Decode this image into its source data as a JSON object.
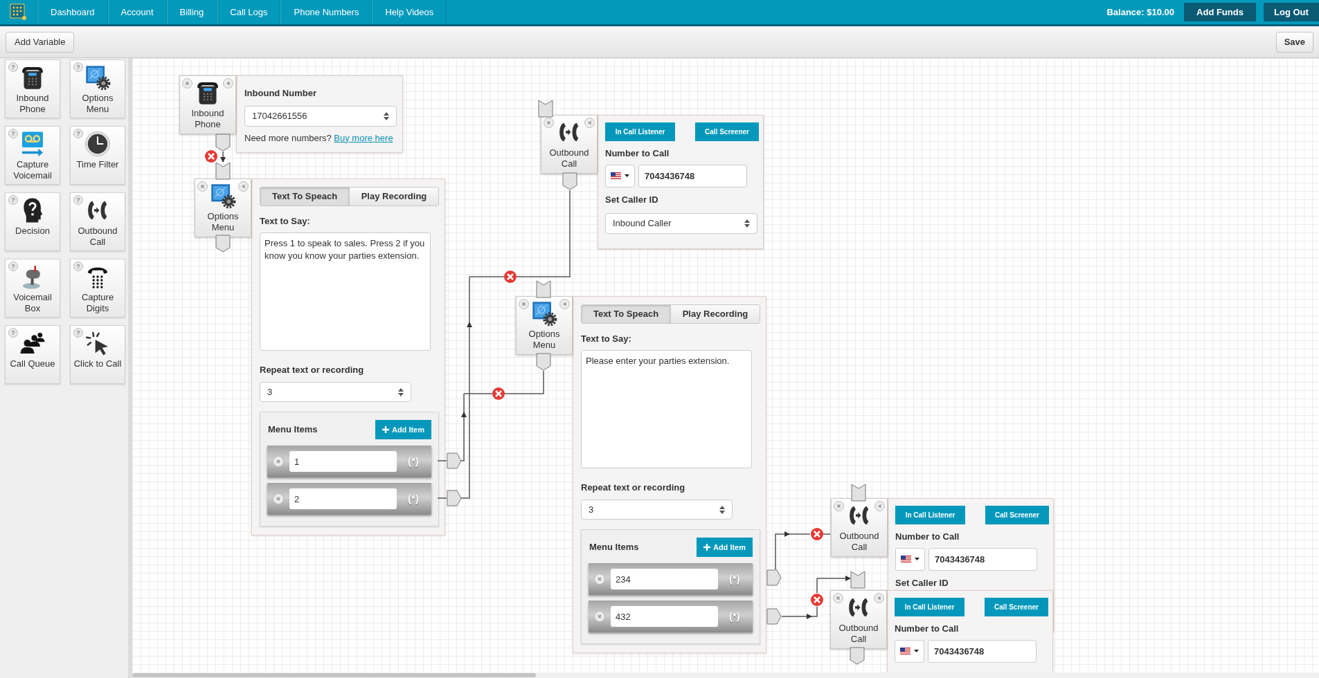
{
  "nav": {
    "items": [
      "Dashboard",
      "Account",
      "Billing",
      "Call Logs",
      "Phone Numbers",
      "Help Videos"
    ],
    "balance": "Balance: $10.00",
    "buttons": [
      "Add Funds",
      "Log Out"
    ]
  },
  "toolbar": {
    "add_variable": "Add Variable",
    "save": "Save"
  },
  "palette": [
    {
      "kind": "inbound_phone",
      "label": "Inbound Phone",
      "help": "?"
    },
    {
      "kind": "options_menu",
      "label": "Options Menu",
      "help": "?"
    },
    {
      "kind": "capture_voicemail",
      "label": "Capture Voicemail",
      "help": "?"
    },
    {
      "kind": "time_filter",
      "label": "Time Filter",
      "help": "?"
    },
    {
      "kind": "decision",
      "label": "Decision",
      "help": "?"
    },
    {
      "kind": "outbound_call",
      "label": "Outbound Call",
      "help": "?"
    },
    {
      "kind": "voicemail_box",
      "label": "Voicemail Box",
      "help": "?"
    },
    {
      "kind": "capture_digits",
      "label": "Capture Digits",
      "help": "?"
    },
    {
      "kind": "call_queue",
      "label": "Call Queue",
      "help": "?"
    },
    {
      "kind": "click_to_call",
      "label": "Click to Call",
      "help": "?"
    }
  ],
  "nodes": [
    {
      "kind": "inbound_phone",
      "label": "Inbound Phone",
      "heading": "Inbound Number",
      "number": "17042661556",
      "note": "Need more numbers?",
      "link": "Buy more here"
    },
    {
      "kind": "options_menu",
      "label": "Options Menu",
      "tabs": [
        {
          "label": "Text To Speach",
          "selected": true
        },
        {
          "label": "Play Recording",
          "selected": false
        }
      ],
      "text_label": "Text to Say:",
      "text": "Press 1 to speak to sales. Press 2 if you know you know your parties extension.",
      "repeat_label": "Repeat text or recording",
      "repeat": "3",
      "menu_title": "Menu Items",
      "add_item": "Add Item",
      "items": [
        {
          "value": "1",
          "wildcard": "(*)"
        },
        {
          "value": "2",
          "wildcard": "(*)"
        }
      ]
    },
    {
      "kind": "outbound_call",
      "label": "Outbound Call",
      "buttons": [
        "In Call Listener",
        "Call Screener"
      ],
      "number_label": "Number to Call",
      "number": "7043436748",
      "caller_id_label": "Set Caller ID",
      "caller_id": "Inbound Caller"
    },
    {
      "kind": "options_menu",
      "label": "Options Menu",
      "tabs": [
        {
          "label": "Text To Speach",
          "selected": true
        },
        {
          "label": "Play Recording",
          "selected": false
        }
      ],
      "text_label": "Text to Say:",
      "text": "Please enter your parties extension.",
      "repeat_label": "Repeat text or recording",
      "repeat": "3",
      "menu_title": "Menu Items",
      "add_item": "Add Item",
      "items": [
        {
          "value": "234",
          "wildcard": "(*)"
        },
        {
          "value": "432",
          "wildcard": "(*)"
        }
      ]
    },
    {
      "kind": "outbound_call",
      "label": "Outbound Call",
      "buttons": [
        "In Call Listener",
        "Call Screener"
      ],
      "number_label": "Number to Call",
      "number": "7043436748",
      "caller_id_label": "Set Caller ID"
    },
    {
      "kind": "outbound_call",
      "label": "Outbound Call",
      "buttons": [
        "In Call Listener",
        "Call Screener"
      ],
      "number_label": "Number to Call",
      "number": "7043436748"
    }
  ]
}
